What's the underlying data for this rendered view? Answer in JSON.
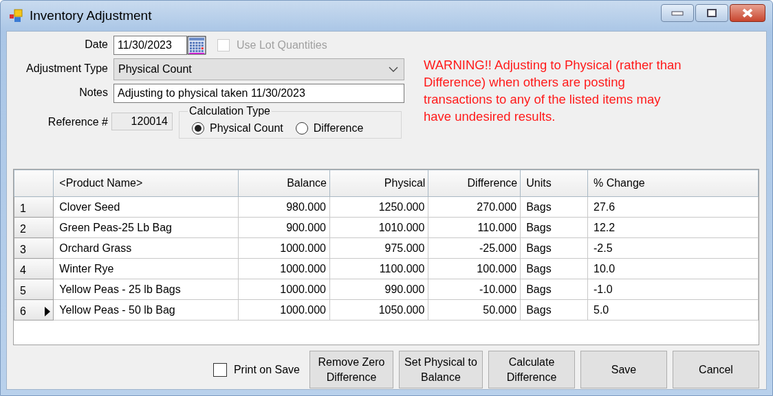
{
  "window": {
    "title": "Inventory Adjustment"
  },
  "form": {
    "date": {
      "label": "Date",
      "value": "11/30/2023"
    },
    "use_lot_quantities": {
      "label": "Use Lot Quantities",
      "checked": false,
      "disabled": true
    },
    "adjustment_type": {
      "label": "Adjustment Type",
      "value": "Physical Count"
    },
    "notes": {
      "label": "Notes",
      "value": "Adjusting to physical taken 11/30/2023"
    },
    "reference": {
      "label": "Reference #",
      "value": "120014"
    },
    "calculation_type": {
      "label": "Calculation Type",
      "options": [
        {
          "label": "Physical Count",
          "selected": true
        },
        {
          "label": "Difference",
          "selected": false
        }
      ]
    },
    "warning": "WARNING!! Adjusting to Physical (rather than Difference) when others are posting transactions to any of the listed items may have undesired results."
  },
  "table": {
    "columns": [
      "<Product Name>",
      "Balance",
      "Physical",
      "Difference",
      "Units",
      "% Change"
    ],
    "rows": [
      {
        "number": "1",
        "current": false,
        "cells": [
          "Clover Seed",
          "980.000",
          "1250.000",
          "270.000",
          "Bags",
          "27.6"
        ]
      },
      {
        "number": "2",
        "current": false,
        "cells": [
          "Green Peas-25 Lb Bag",
          "900.000",
          "1010.000",
          "110.000",
          "Bags",
          "12.2"
        ]
      },
      {
        "number": "3",
        "current": false,
        "cells": [
          "Orchard Grass",
          "1000.000",
          "975.000",
          "-25.000",
          "Bags",
          "-2.5"
        ]
      },
      {
        "number": "4",
        "current": false,
        "cells": [
          "Winter Rye",
          "1000.000",
          "1100.000",
          "100.000",
          "Bags",
          "10.0"
        ]
      },
      {
        "number": "5",
        "current": false,
        "cells": [
          "Yellow Peas - 25 lb Bags",
          "1000.000",
          "990.000",
          "-10.000",
          "Bags",
          "-1.0"
        ]
      },
      {
        "number": "6",
        "current": true,
        "cells": [
          "Yellow Peas - 50 lb Bag",
          "1000.000",
          "1050.000",
          "50.000",
          "Bags",
          "5.0"
        ]
      }
    ]
  },
  "footer": {
    "print_on_save": {
      "label": "Print on Save",
      "checked": false
    },
    "buttons": [
      "Remove Zero Difference",
      "Set Physical to Balance",
      "Calculate Difference",
      "Save",
      "Cancel"
    ]
  }
}
